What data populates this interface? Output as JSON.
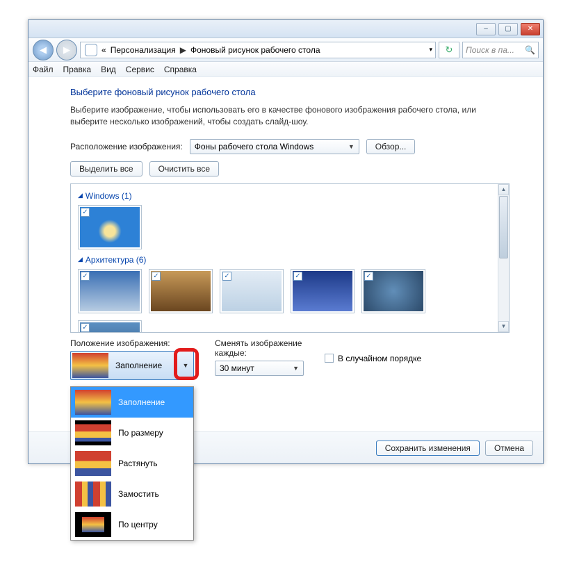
{
  "titlebar": {
    "minimize": "–",
    "maximize": "▢",
    "close": "✕"
  },
  "nav": {
    "back_glyph": "◀",
    "fwd_glyph": "▶",
    "chevron": "«",
    "breadcrumb": {
      "level1": "Персонализация",
      "arrow": "▶",
      "level2": "Фоновый рисунок рабочего стола"
    },
    "dd_caret": "▾",
    "refresh_glyph": "↻",
    "search_placeholder": "Поиск в па...",
    "search_icon": "🔍"
  },
  "menubar": {
    "file": "Файл",
    "edit": "Правка",
    "view": "Вид",
    "tools": "Сервис",
    "help": "Справка"
  },
  "content": {
    "heading": "Выберите фоновый рисунок рабочего стола",
    "desc": "Выберите изображение, чтобы использовать его в качестве фонового изображения рабочего стола, или выберите несколько изображений, чтобы создать слайд-шоу.",
    "location_label": "Расположение изображения:",
    "location_value": "Фоны рабочего стола Windows",
    "browse": "Обзор...",
    "select_all": "Выделить все",
    "clear_all": "Очистить все",
    "group1": "Windows (1)",
    "group2": "Архитектура (6)"
  },
  "bottom": {
    "pos_label": "Положение изображения:",
    "pos_value": "Заполнение",
    "interval_label_a": "Сменять изображение",
    "interval_label_b": "каждые:",
    "interval_value": "30 минут",
    "shuffle": "В случайном порядке"
  },
  "popup": {
    "fill": "Заполнение",
    "fit": "По размеру",
    "stretch": "Растянуть",
    "tile": "Замостить",
    "center": "По центру"
  },
  "footer": {
    "save": "Сохранить изменения",
    "cancel": "Отмена"
  }
}
